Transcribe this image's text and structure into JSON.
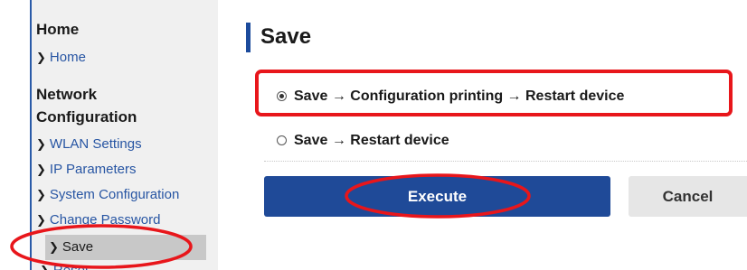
{
  "sidebar": {
    "sections": [
      {
        "heading": "Home",
        "items": [
          {
            "label": "Home"
          }
        ]
      },
      {
        "heading_line1": "Network",
        "heading_line2": "Configuration",
        "items": [
          {
            "label": "WLAN Settings"
          },
          {
            "label": "IP Parameters"
          },
          {
            "label": "System Configuration"
          },
          {
            "label": "Change Password"
          },
          {
            "label": "Save",
            "selected": true
          },
          {
            "label": "Reset"
          }
        ]
      }
    ]
  },
  "main": {
    "title": "Save",
    "options": [
      {
        "label": "Save → Configuration printing → Restart device",
        "checked": true
      },
      {
        "label": "Save → Restart device",
        "checked": false
      }
    ],
    "buttons": {
      "execute": "Execute",
      "cancel": "Cancel"
    }
  },
  "colors": {
    "accent": "#1f4a98",
    "link": "#2755a3",
    "annotation": "#e8161b",
    "sidebar_bg": "#f0f0f0",
    "selected_bg": "#c8c8c8"
  }
}
